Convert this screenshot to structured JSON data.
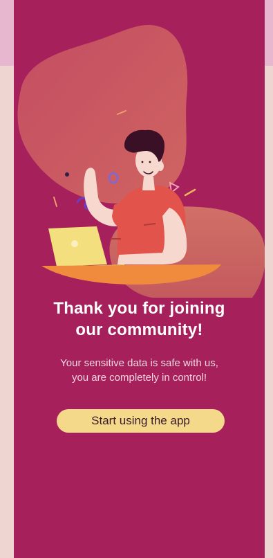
{
  "onboarding": {
    "headline_line1": "Thank you for joining",
    "headline_line2": "our community!",
    "subtext_line1": "Your sensitive data is safe with us,",
    "subtext_line2": "you are completely in control!",
    "cta_label": "Start using the app"
  },
  "colors": {
    "page_background": "#f0d7d3",
    "screen_background": "#a6205c",
    "cta_background": "#f5d98a",
    "blob": "#c6555f"
  }
}
